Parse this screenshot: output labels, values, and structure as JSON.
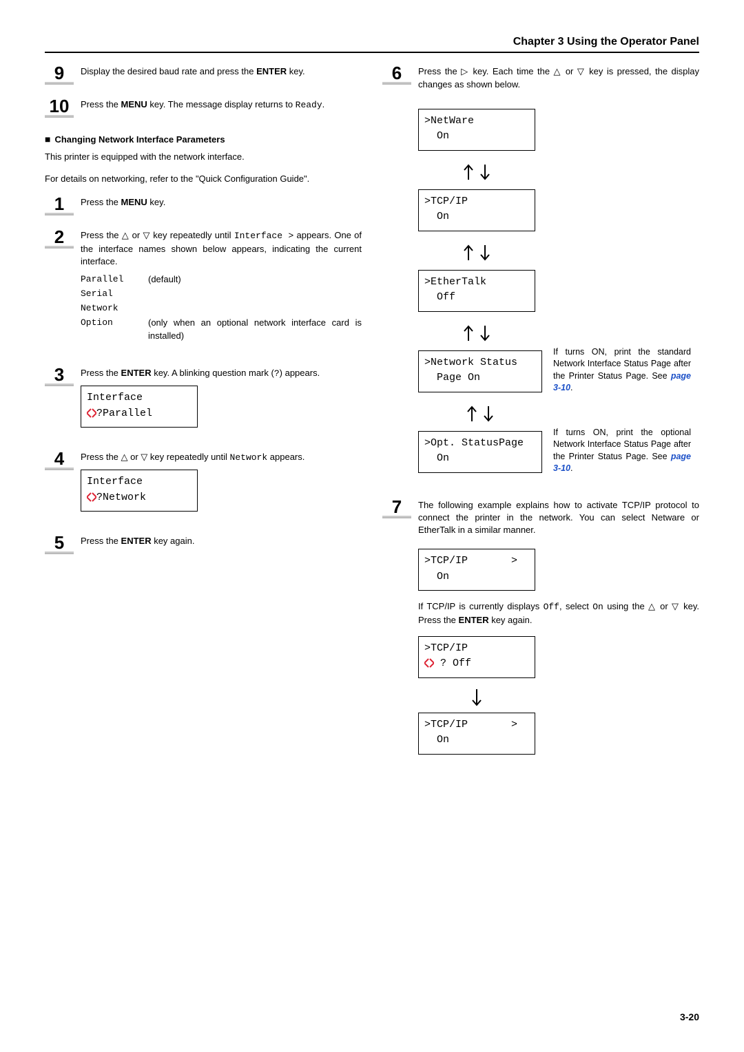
{
  "header": {
    "title": "Chapter 3  Using the Operator Panel"
  },
  "footer": {
    "page": "3-20"
  },
  "left": {
    "step9": {
      "pre": "Display the desired baud rate and press the ",
      "enter": "ENTER",
      "post": " key."
    },
    "step10": {
      "pre": "Press the ",
      "menu": "MENU",
      "mid": " key. The message display returns to ",
      "ready": "Ready",
      "post": "."
    },
    "heading": "Changing Network Interface Parameters",
    "intro1": "This printer is equipped with the network interface.",
    "intro2": "For details on networking, refer to the \"Quick Configuration Guide\".",
    "step1": {
      "pre": "Press the ",
      "menu": "MENU",
      "post": " key."
    },
    "step2": {
      "pre": "Press the △ or ▽ key repeatedly until ",
      "iface": "Interface >",
      "mid": " appears. One of the interface names shown below appears, indicating the current interface."
    },
    "interfaces": {
      "parallel": {
        "name": "Parallel",
        "desc": "(default)"
      },
      "serial": {
        "name": "Serial",
        "desc": ""
      },
      "network": {
        "name": "Network",
        "desc": ""
      },
      "option": {
        "name": "Option",
        "desc": "(only when an optional network interface card is installed)"
      }
    },
    "step3": {
      "pre": "Press the ",
      "enter": "ENTER",
      "mid": " key. A blinking question mark (",
      "q": "?",
      "post": ") appears."
    },
    "box3_line1": "Interface",
    "box3_line2": "Parallel",
    "step4": {
      "pre": "Press the △ or ▽ key repeatedly until ",
      "net": "Network",
      "post": " appears."
    },
    "box4_line1": "Interface",
    "box4_line2": "Network",
    "step5": {
      "pre": "Press the ",
      "enter": "ENTER",
      "post": " key again."
    }
  },
  "right": {
    "step6": {
      "pre": "Press the ▷ key. Each time the △ or ▽ key is pressed, the display changes as shown below."
    },
    "boxA": {
      "l1": ">NetWare",
      "l2": "  On"
    },
    "boxB": {
      "l1": ">TCP/IP",
      "l2": "  On"
    },
    "boxC": {
      "l1": ">EtherTalk",
      "l2": "  Off"
    },
    "boxD": {
      "l1": ">Network Status",
      "l2": "  Page On"
    },
    "boxE": {
      "l1": ">Opt. StatusPage",
      "l2": "  On"
    },
    "noteD": {
      "text": "If turns ON, print the standard Network Interface Status Page after the Printer Status Page. See ",
      "link": "page 3-10",
      "post": "."
    },
    "noteE": {
      "text": "If turns ON, print the optional Network Interface Status Page after the Printer Status Page. See ",
      "link": "page 3-10",
      "post": "."
    },
    "step7": {
      "text": "The following example explains how to activate TCP/IP protocol to connect the printer in the network. You can select Netware or EtherTalk in a similar manner."
    },
    "box7": {
      "l1": ">TCP/IP       >",
      "l2": "  On"
    },
    "para7b": {
      "pre": "If TCP/IP is currently displays ",
      "off": "Off",
      "mid": ", select ",
      "on": "On",
      "mid2": " using the △ or ▽ key. Press the ",
      "enter": "ENTER",
      "post": " key again."
    },
    "box8": {
      "l1": ">TCP/IP",
      "l2": " ? Off"
    },
    "box9": {
      "l1": ">TCP/IP       >",
      "l2": "  On"
    }
  }
}
